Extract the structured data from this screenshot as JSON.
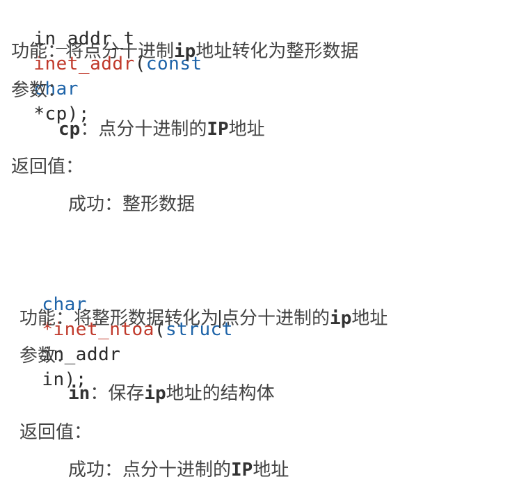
{
  "func1": {
    "signature": {
      "return_type": "in_addr_t",
      "name": "inet_addr",
      "open_paren": "(",
      "param_kw1": "const",
      "param_kw2": "char",
      "param_name": "*cp",
      "close": ");"
    },
    "function_label": "功能：",
    "function_desc_1": "将点分十进制",
    "function_desc_ip": "ip",
    "function_desc_2": "地址转化为整形数据",
    "params_label": "参数：",
    "param_line_name": "cp",
    "param_line_sep": "：",
    "param_line_desc_1": "点分十进制的",
    "param_line_desc_ip": "IP",
    "param_line_desc_2": "地址",
    "return_label": "返回值：",
    "success_label": "成功：",
    "success_desc": "整形数据"
  },
  "func2": {
    "signature": {
      "return_type": "char",
      "name": "*inet_ntoa",
      "open_paren": "(",
      "param_kw": "struct",
      "param_type": "in_addr",
      "param_name": "in",
      "close": ");"
    },
    "function_label": "功能：",
    "function_desc_1": "将整形数据转化为",
    "function_desc_2": "点分十进制的",
    "function_desc_ip": "ip",
    "function_desc_3": "地址",
    "params_label": "参数：",
    "param_line_name": "in",
    "param_line_sep": "：",
    "param_line_desc_1": "保存",
    "param_line_desc_ip": "ip",
    "param_line_desc_2": "地址的结构体",
    "return_label": "返回值：",
    "success_label": "成功：",
    "success_desc_1": "点分十进制的",
    "success_desc_ip": "IP",
    "success_desc_2": "地址"
  }
}
